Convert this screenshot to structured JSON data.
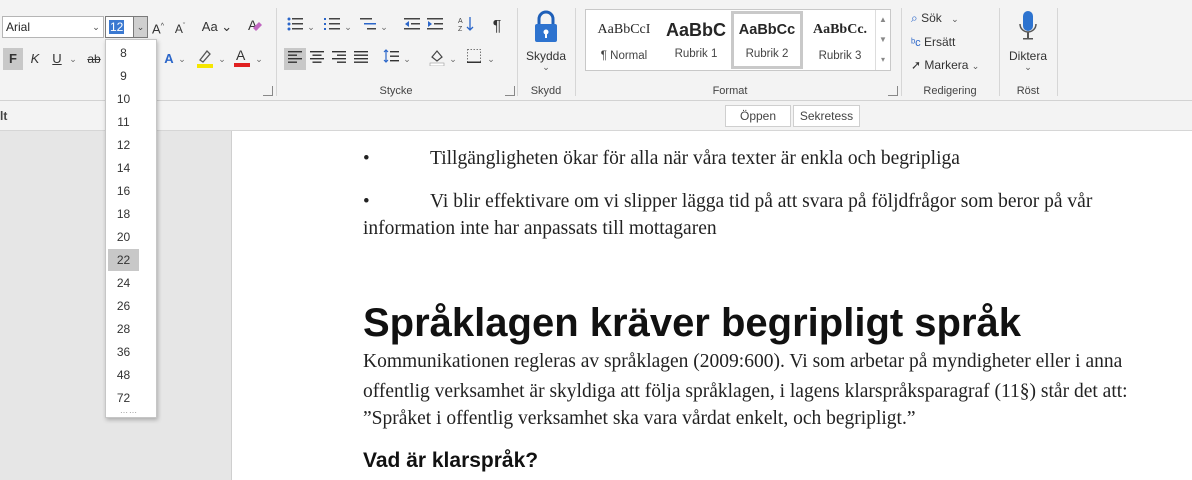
{
  "ribbon": {
    "font": {
      "family_value": "Arial",
      "size_value": "12"
    },
    "groups": {
      "stycke": "Stycke",
      "skydd": "Skydd",
      "format": "Format",
      "redigering": "Redigering",
      "rost": "Röst"
    },
    "skydd_button": {
      "line1": "Skydda",
      "arrow": "⌄"
    },
    "styles": [
      {
        "preview": "AaBbCcI",
        "name": "¶ Normal"
      },
      {
        "preview": "AaBbC",
        "name": "Rubrik 1"
      },
      {
        "preview": "AaBbCc",
        "name": "Rubrik 2"
      },
      {
        "preview": "AaBbCc.",
        "name": "Rubrik 3"
      }
    ],
    "editing": {
      "search": "Sök",
      "replace": "Ersätt",
      "select": "Markera"
    },
    "dictate": {
      "label": "Diktera"
    },
    "font_buttons": {
      "bold": "F",
      "italic": "K",
      "underline": "U",
      "strike": "ab"
    }
  },
  "subbar": {
    "left_fragment": "lt",
    "open": "Öppen",
    "secrecy": "Sekretess"
  },
  "font_size_options": [
    "8",
    "9",
    "10",
    "11",
    "12",
    "14",
    "16",
    "18",
    "20",
    "22",
    "24",
    "26",
    "28",
    "36",
    "48",
    "72"
  ],
  "font_size_highlighted": "22",
  "document": {
    "bullets": [
      {
        "symbol": "•",
        "line1": "Tillgängligheten ökar för alla när våra texter är enkla och begripliga"
      },
      {
        "symbol": "•",
        "line1": "Vi blir effektivare om vi slipper lägga tid på att svara på följdfrågor som beror på vår",
        "line2": "information inte har anpassats till mottagaren"
      }
    ],
    "heading": "Språklagen kräver begripligt språk",
    "paragraph": [
      "Kommunikationen regleras av språklagen (2009:600). Vi som arbetar på myndigheter eller i anna",
      "offentlig verksamhet är skyldiga att följa språklagen, i lagens klarspråksparagraf (11§) står det att:",
      "”Språket i offentlig verksamhet ska vara vårdat enkelt, och begripligt.”"
    ],
    "subheading": "Vad är klarspråk?"
  }
}
